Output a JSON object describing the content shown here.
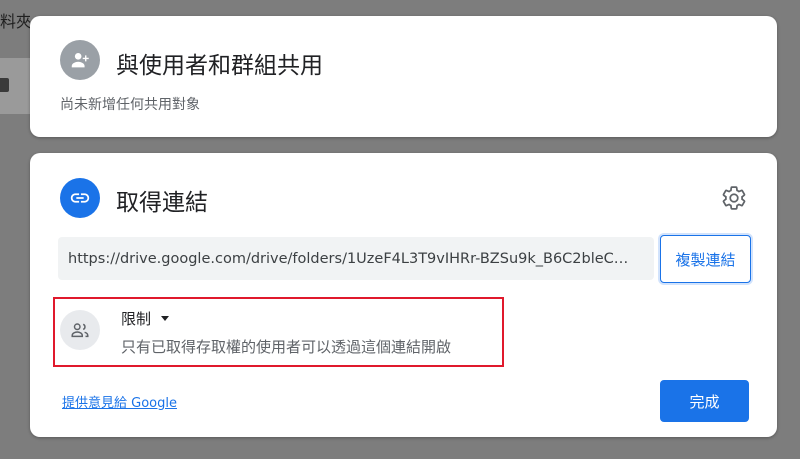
{
  "background": {
    "partial_text": "料夾"
  },
  "share_card": {
    "title": "與使用者和群組共用",
    "subtitle": "尚未新增任何共用對象",
    "icon": "person-add-icon"
  },
  "link_card": {
    "title": "取得連結",
    "icon": "link-icon",
    "settings_icon": "gear-icon",
    "url": "https://drive.google.com/drive/folders/1UzeF4L3T9vIHRr-BZSu9k_B6C2bleC…",
    "copy_button": "複製連結",
    "access": {
      "label": "限制",
      "description": "只有已取得存取權的使用者可以透過這個連結開啟",
      "icon": "people-icon"
    },
    "feedback_link": "提供意見給 Google",
    "done_button": "完成"
  },
  "colors": {
    "accent": "#1a73e8",
    "highlight_border": "#e0192c",
    "overlay": "#7d7d7d"
  }
}
